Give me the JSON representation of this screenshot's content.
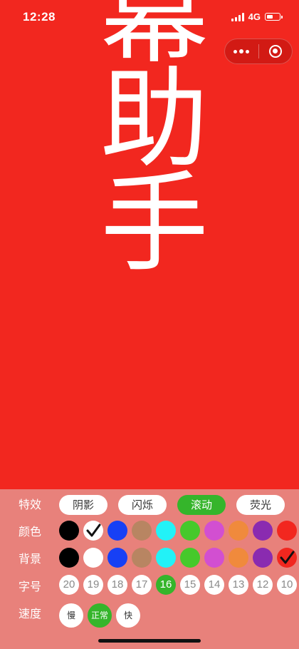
{
  "status_bar": {
    "time": "12:28",
    "network": "4G",
    "battery_level": 0.5
  },
  "marquee": {
    "text": "幕助手"
  },
  "panel": {
    "effects": {
      "label": "特效",
      "options": [
        "阴影",
        "闪烁",
        "滚动",
        "荧光"
      ],
      "selected": "滚动"
    },
    "text_color": {
      "label": "颜色",
      "swatches": [
        "#000000",
        "#ffffff",
        "#1740f5",
        "#b88562",
        "#22f2f7",
        "#46c92b",
        "#d24fd1",
        "#f08a3c",
        "#8a2bb0",
        "#f2271f"
      ],
      "selected_index": 1
    },
    "background": {
      "label": "背景",
      "swatches": [
        "#000000",
        "#ffffff",
        "#1740f5",
        "#b88562",
        "#22f2f7",
        "#46c92b",
        "#d24fd1",
        "#f08a3c",
        "#8a2bb0",
        "#f2271f"
      ],
      "selected_index": 9
    },
    "font_size": {
      "label": "字号",
      "options": [
        "20",
        "19",
        "18",
        "17",
        "16",
        "15",
        "14",
        "13",
        "12",
        "10"
      ],
      "selected": "16"
    },
    "speed": {
      "label": "速度",
      "options": [
        "慢",
        "正常",
        "快"
      ],
      "selected": "正常"
    }
  },
  "colors": {
    "accent": "#35b52b",
    "panel_bg": "#e8817b",
    "screen_bg": "#f2271f"
  }
}
